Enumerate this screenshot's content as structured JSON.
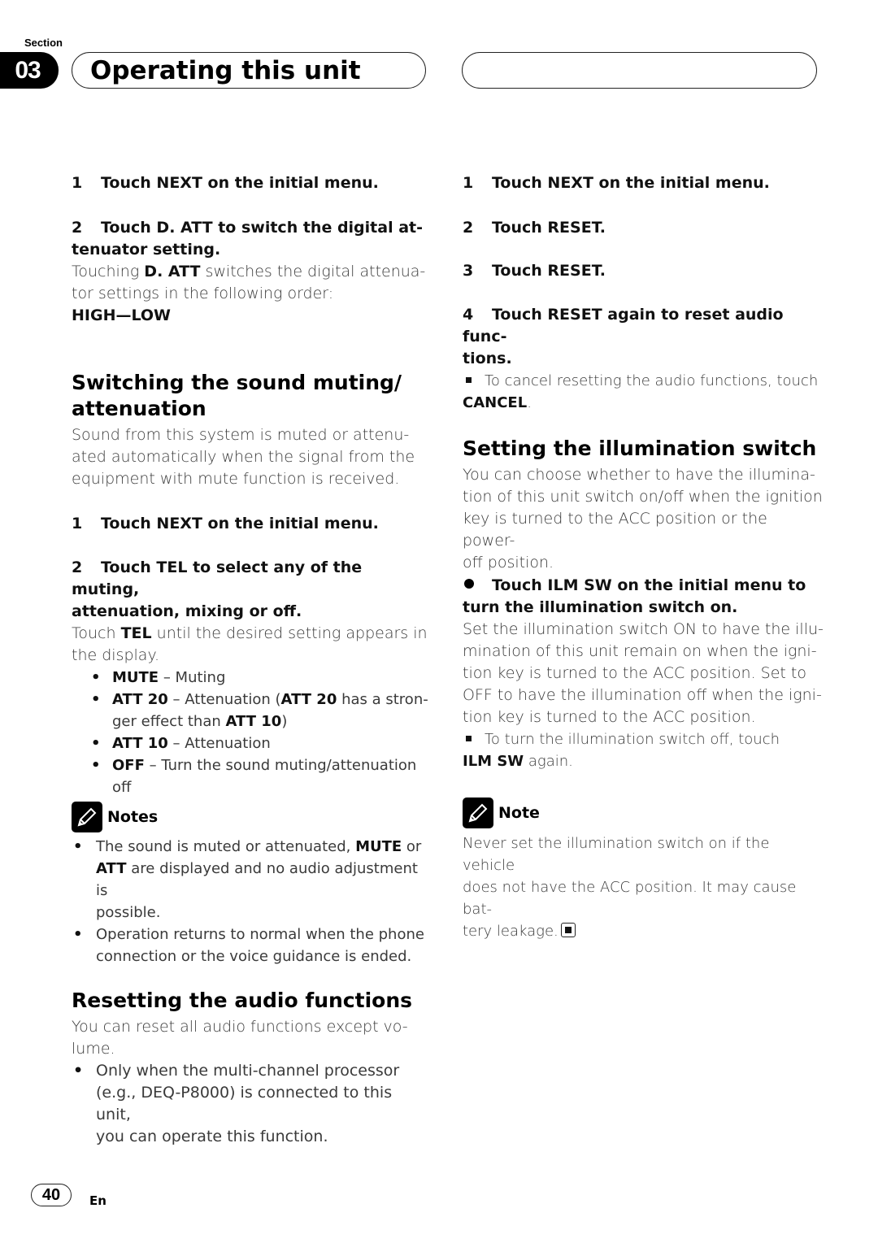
{
  "header": {
    "section_label": "Section",
    "section_number": "03",
    "title": "Operating this unit"
  },
  "left": {
    "step1": {
      "num": "1",
      "text": "Touch NEXT on the initial menu."
    },
    "step2": {
      "num": "2",
      "text_line1": "Touch D. ATT to switch the digital at-",
      "text_line2": "tenuator setting."
    },
    "step2_body": {
      "pre": "Touching ",
      "bold": "D. ATT",
      "post_line1": " switches the digital attenua-",
      "line2": "tor settings in the following order:"
    },
    "order": "HIGH—LOW",
    "muting_section": {
      "heading_line1": "Switching the sound muting/",
      "heading_line2": "attenuation",
      "intro_line1": "Sound from this system is muted or attenu-",
      "intro_line2": "ated automatically when the signal from the",
      "intro_line3": "equipment with mute function is received.",
      "step1": {
        "num": "1",
        "text": "Touch NEXT on the initial menu."
      },
      "step2": {
        "num": "2",
        "text_line1": "Touch TEL to select any of the muting,",
        "text_line2": "attenuation, mixing or off."
      },
      "step2_body": {
        "pre": "Touch ",
        "bold": "TEL",
        "post": " until the desired setting appears in",
        "line2": "the display."
      },
      "options": [
        {
          "bold": "MUTE",
          "text": " – Muting"
        },
        {
          "bold": "ATT 20",
          "text": " – Attenuation (",
          "bold2": "ATT 20",
          "text2": " has a stron-",
          "line2": "ger effect than ",
          "bold3": "ATT 10",
          "text3": ")"
        },
        {
          "bold": "ATT 10",
          "text": " – Attenuation"
        },
        {
          "bold": "OFF",
          "text": " – Turn the sound muting/attenuation",
          "line2": "off"
        }
      ],
      "bullet_char": "•"
    },
    "notes": {
      "title": "Notes",
      "items": [
        {
          "pre": "The sound is muted or attenuated, ",
          "bold": "MUTE",
          "mid": " or",
          "bold2": "ATT",
          "post": " are displayed and no audio adjustment is",
          "line3": "possible."
        },
        {
          "line1": "Operation returns to normal when the phone",
          "line2": "connection or the voice guidance is ended."
        }
      ]
    },
    "reset_section": {
      "heading": "Resetting the audio functions",
      "intro_line1": "You can reset all audio functions except vo-",
      "intro_line2": "lume.",
      "bullet": {
        "line1": "Only when the multi-channel processor",
        "line2": "(e.g., DEQ-P8000) is connected to this unit,",
        "line3": "you can operate this function."
      }
    }
  },
  "right": {
    "steps": [
      {
        "num": "1",
        "text": "Touch NEXT on the initial menu."
      },
      {
        "num": "2",
        "text": "Touch RESET."
      },
      {
        "num": "3",
        "text": "Touch RESET."
      },
      {
        "num": "4",
        "text_line1": "Touch RESET again to reset audio func-",
        "text_line2": "tions."
      }
    ],
    "cancel_tip": {
      "text": "To cancel resetting the audio functions, touch",
      "bold": "CANCEL",
      "post": "."
    },
    "illumination_section": {
      "heading": "Setting the illumination switch",
      "intro": [
        "You can choose whether to have the illumina-",
        "tion of this unit switch on/off when the ignition",
        "key is turned to the ACC position or the power-",
        "off position."
      ],
      "action_line1": "Touch ILM SW on the initial menu to",
      "action_line2": "turn the illumination switch on.",
      "body": [
        "Set the illumination switch ON to have the illu-",
        "mination of this unit remain on when the igni-",
        "tion key is turned to the ACC position. Set to",
        "OFF to have the illumination off when the igni-",
        "tion key is turned to the ACC position."
      ],
      "off_tip": {
        "text": "To turn the illumination switch off, touch",
        "bold": "ILM SW",
        "post": " again."
      }
    },
    "note": {
      "title": "Note",
      "lines": [
        "Never set the illumination switch on if the vehicle",
        "does not have the ACC position. It may cause bat-",
        "tery leakage."
      ]
    }
  },
  "footer": {
    "page_number": "40",
    "language": "En"
  }
}
